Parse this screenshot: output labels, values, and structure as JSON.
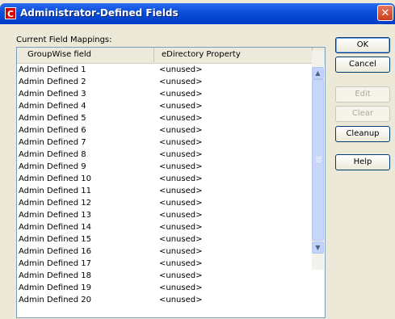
{
  "window": {
    "title": "Administrator-Defined Fields",
    "icon_letter": "C",
    "close_glyph": "✕"
  },
  "group_label": "Current Field Mappings:",
  "columns": [
    "GroupWise field",
    "eDirectory Property"
  ],
  "rows": [
    {
      "field": "Admin Defined 1",
      "property": "<unused>"
    },
    {
      "field": "Admin Defined 2",
      "property": "<unused>"
    },
    {
      "field": "Admin Defined 3",
      "property": "<unused>"
    },
    {
      "field": "Admin Defined 4",
      "property": "<unused>"
    },
    {
      "field": "Admin Defined 5",
      "property": "<unused>"
    },
    {
      "field": "Admin Defined 6",
      "property": "<unused>"
    },
    {
      "field": "Admin Defined 7",
      "property": "<unused>"
    },
    {
      "field": "Admin Defined 8",
      "property": "<unused>"
    },
    {
      "field": "Admin Defined 9",
      "property": "<unused>"
    },
    {
      "field": "Admin Defined 10",
      "property": "<unused>"
    },
    {
      "field": "Admin Defined 11",
      "property": "<unused>"
    },
    {
      "field": "Admin Defined 12",
      "property": "<unused>"
    },
    {
      "field": "Admin Defined 13",
      "property": "<unused>"
    },
    {
      "field": "Admin Defined 14",
      "property": "<unused>"
    },
    {
      "field": "Admin Defined 15",
      "property": "<unused>"
    },
    {
      "field": "Admin Defined 16",
      "property": "<unused>"
    },
    {
      "field": "Admin Defined 17",
      "property": "<unused>"
    },
    {
      "field": "Admin Defined 18",
      "property": "<unused>"
    },
    {
      "field": "Admin Defined 19",
      "property": "<unused>"
    },
    {
      "field": "Admin Defined 20",
      "property": "<unused>"
    }
  ],
  "buttons": {
    "ok": "OK",
    "cancel": "Cancel",
    "edit": "Edit",
    "clear": "Clear",
    "cleanup": "Cleanup",
    "help": "Help"
  },
  "scrollbar": {
    "up_glyph": "▲",
    "down_glyph": "▼"
  },
  "colors": {
    "titlebar": "#0a4ed8",
    "dialog_bg": "#ece9d8",
    "close": "#c8401e",
    "app_icon": "#d40000"
  }
}
